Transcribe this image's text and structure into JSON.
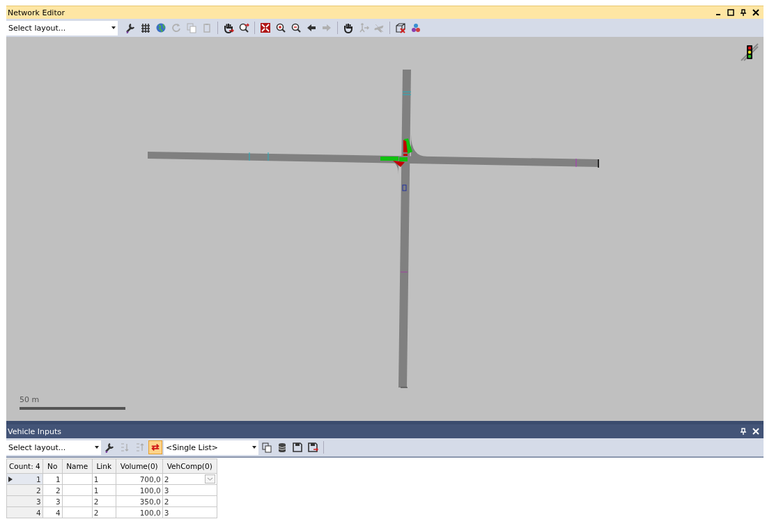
{
  "network_editor": {
    "title": "Network Editor",
    "layout_select": {
      "placeholder": "Select layout..."
    },
    "scale_label": "50 m"
  },
  "vehicle_inputs": {
    "title": "Vehicle Inputs",
    "layout_select": {
      "placeholder": "Select layout..."
    },
    "sync_on": true,
    "list_select": {
      "value": "<Single List>"
    },
    "table": {
      "columns": [
        "Count: 4",
        "No",
        "Name",
        "Link",
        "Volume(0)",
        "VehComp(0)"
      ],
      "rows": [
        {
          "index": "1",
          "no": "1",
          "link": "1",
          "volume": "700,0",
          "veh_comp": "2",
          "selected": true
        },
        {
          "index": "2",
          "no": "2",
          "link": "1",
          "volume": "100,0",
          "veh_comp": "3",
          "selected": false
        },
        {
          "index": "3",
          "no": "3",
          "link": "2",
          "volume": "350,0",
          "veh_comp": "2",
          "selected": false
        },
        {
          "index": "4",
          "no": "4",
          "link": "2",
          "volume": "100,0",
          "veh_comp": "3",
          "selected": false
        }
      ]
    }
  }
}
